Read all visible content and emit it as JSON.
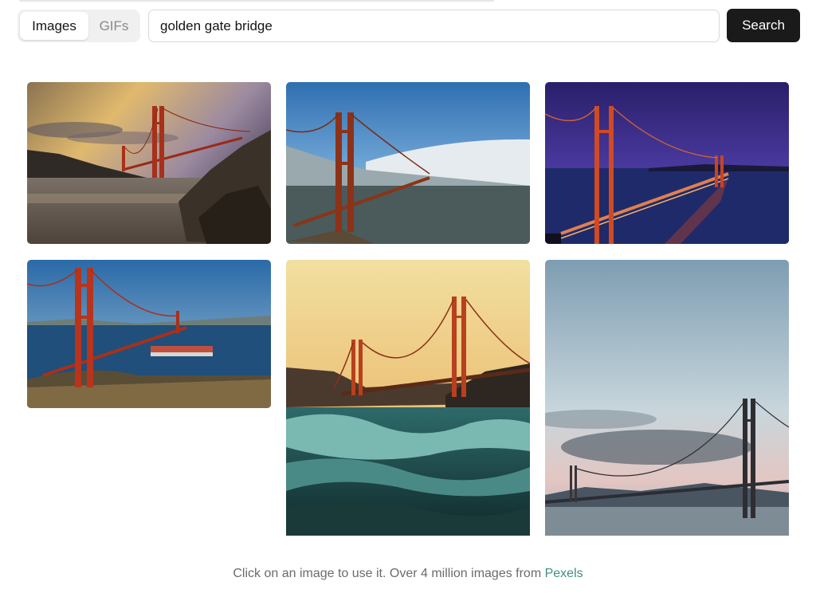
{
  "tabs": {
    "images_label": "Images",
    "gifs_label": "GIFs",
    "active": "Images"
  },
  "search": {
    "value": "golden gate bridge",
    "button_label": "Search"
  },
  "results": [
    {
      "subject": "golden gate bridge at sunset from rocky shore"
    },
    {
      "subject": "golden gate bridge with fog"
    },
    {
      "subject": "golden gate bridge at night"
    },
    {
      "subject": "golden gate bridge with container ship"
    },
    {
      "subject": "golden gate bridge with ocean waves"
    },
    {
      "subject": "golden gate bridge at dusk"
    }
  ],
  "footer": {
    "text": "Click on an image to use it. Over 4 million images from",
    "link_label": "Pexels"
  },
  "colors": {
    "search_button_bg": "#1a1a1a",
    "link": "#3f8f84",
    "bridge": "#c23a1e"
  }
}
